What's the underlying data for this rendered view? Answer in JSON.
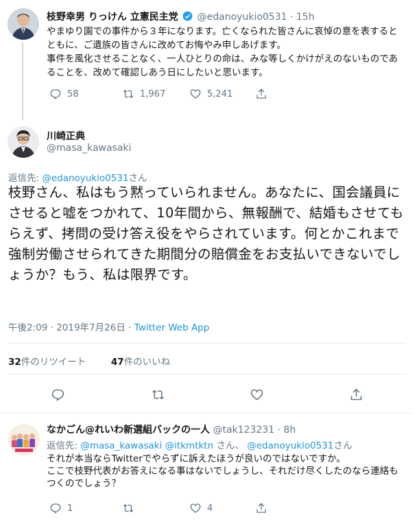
{
  "tweet1": {
    "name": "枝野幸男 りっけん 立憲民主党",
    "handle": "@edanoyukio0531",
    "time": "· 15h",
    "body": "やまゆり園での事件から３年になります。亡くなられた皆さんに哀悼の意を表するとともに、ご遺族の皆さんに改めてお悔やみ申しあげます。\n事件を風化させることなく、一人ひとりの命は、みな等しくかけがえのないものであることを、改めて確認しあう日にしたいと思います。",
    "replies": "58",
    "retweets": "1,967",
    "likes": "5,241"
  },
  "main": {
    "name": "川崎正典",
    "handle": "@masa_kawasaki",
    "reply_prefix": "返信先: ",
    "reply_to": "@edanoyukio0531",
    "reply_suffix": "さん",
    "body": "枝野さん、私はもう黙っていられません。あなたに、国会議員にさせると嘘をつかれて、10年間から、無報酬で、結婚もさせてもらえず、拷問の受け答え役をやらされています。何とかこれまで強制労働させられてきた期間分の賠償金をお支払いできないでしょうか？もう、私は限界です。",
    "timestamp": "午後2:09 · 2019年7月26日 · ",
    "source": "Twitter Web App",
    "retweet_count": "32",
    "retweet_label": "件のリツイート",
    "like_count": "47",
    "like_label": "件のいいね"
  },
  "tweet3": {
    "name": "なかごん@れいわ新選組バックの一人",
    "handle": "@tak123231",
    "time": "· 8h",
    "reply_prefix": "返信先: ",
    "reply_to1": "@masa_kawasaki",
    "reply_to2": "@itkmtktn",
    "reply_mid": " さん、 ",
    "reply_to3": "@edanoyukio0531",
    "reply_suffix": "さん",
    "body": "それが本当ならTwitterでやらずに訴えたほうが良いのではないですか。\nここで枝野代表がお答えになる事はないでしょうし、それだけ尽くしたのなら連絡もつくのでしょう？",
    "replies": "1",
    "likes": "4"
  },
  "icons": [
    "reply-icon",
    "retweet-icon",
    "like-icon",
    "share-icon",
    "verified-icon"
  ],
  "colors": {
    "link": "#1b95e0",
    "secondary": "#657786",
    "text": "#14171a",
    "divider": "#e6ecf0"
  }
}
